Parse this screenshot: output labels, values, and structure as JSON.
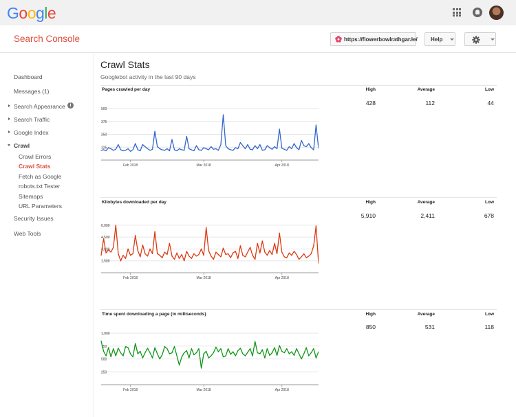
{
  "google_bar": {
    "logo_letters": [
      {
        "ch": "G",
        "color": "#4285f4"
      },
      {
        "ch": "o",
        "color": "#ea4335"
      },
      {
        "ch": "o",
        "color": "#fbbc05"
      },
      {
        "ch": "g",
        "color": "#4285f4"
      },
      {
        "ch": "l",
        "color": "#34a853"
      },
      {
        "ch": "e",
        "color": "#ea4335"
      }
    ],
    "icons": [
      "apps-icon",
      "notifications-icon",
      "account-avatar"
    ]
  },
  "header": {
    "brand": "Search Console",
    "brand_color": "#dd4b39",
    "site_selector": "https://flowerbowlrathgar.ie/",
    "help_label": "Help",
    "settings_icon": "gear-icon"
  },
  "sidebar": {
    "items": [
      {
        "label": "Dashboard",
        "type": "top"
      },
      {
        "label": "Messages (1)",
        "type": "top"
      },
      {
        "label": "Search Appearance",
        "type": "collapsed",
        "info_icon": "i"
      },
      {
        "label": "Search Traffic",
        "type": "collapsed"
      },
      {
        "label": "Google Index",
        "type": "collapsed"
      },
      {
        "label": "Crawl",
        "type": "expanded"
      },
      {
        "label": "Crawl Errors",
        "type": "sub"
      },
      {
        "label": "Crawl Stats",
        "type": "sub-active"
      },
      {
        "label": "Fetch as Google",
        "type": "sub"
      },
      {
        "label": "robots.txt Tester",
        "type": "sub"
      },
      {
        "label": "Sitemaps",
        "type": "sub"
      },
      {
        "label": "URL Parameters",
        "type": "sub"
      },
      {
        "label": "Security Issues",
        "type": "top"
      },
      {
        "label": "Web Tools",
        "type": "top"
      }
    ]
  },
  "main": {
    "title": "Crawl Stats",
    "subtitle": "Googlebot activity in the last 90 days",
    "stat_headers": {
      "high": "High",
      "average": "Average",
      "low": "Low"
    },
    "sections": [
      {
        "title": "Pages crawled per day",
        "high": "428",
        "average": "112",
        "low": "44"
      },
      {
        "title": "Kilobytes downloaded per day",
        "high": "5,910",
        "average": "2,411",
        "low": "678"
      },
      {
        "title": "Time spent downloading a page (in milliseconds)",
        "high": "850",
        "average": "531",
        "low": "118"
      }
    ]
  },
  "chart_data": [
    {
      "type": "line",
      "title": "Pages crawled per day",
      "color": "#3366cc",
      "ylim": [
        0,
        500
      ],
      "yticks": [
        "500",
        "375",
        "250",
        "125"
      ],
      "ytick_values": [
        500,
        375,
        250,
        125
      ],
      "xticks": [
        "Feb 2018",
        "Mar 2018",
        "Apr 2018"
      ],
      "xtick_index": [
        12,
        42,
        74
      ],
      "grid": true,
      "values": [
        95,
        100,
        90,
        120,
        110,
        95,
        105,
        150,
        100,
        90,
        95,
        110,
        85,
        100,
        160,
        100,
        90,
        150,
        130,
        110,
        95,
        105,
        280,
        130,
        110,
        100,
        95,
        110,
        90,
        200,
        100,
        90,
        110,
        100,
        95,
        230,
        110,
        100,
        90,
        140,
        100,
        95,
        120,
        110,
        100,
        130,
        105,
        110,
        95,
        150,
        440,
        140,
        110,
        100,
        95,
        120,
        110,
        170,
        140,
        110,
        150,
        105,
        100,
        140,
        110,
        150,
        95,
        100,
        140,
        120,
        105,
        130,
        110,
        300,
        115,
        105,
        95,
        130,
        110,
        160,
        120,
        100,
        190,
        140,
        130,
        160,
        120,
        100,
        340,
        115
      ]
    },
    {
      "type": "line",
      "title": "Kilobytes downloaded per day",
      "color": "#dc3912",
      "ylim": [
        0,
        6500
      ],
      "yticks": [
        "6,000",
        "4,500",
        "3,000",
        "1,500"
      ],
      "ytick_values": [
        6000,
        4500,
        3000,
        1500
      ],
      "xticks": [
        "Feb 2018",
        "Mar 2018",
        "Apr 2018"
      ],
      "xtick_index": [
        12,
        42,
        74
      ],
      "grid": true,
      "values": [
        2200,
        4300,
        2500,
        2900,
        2600,
        3200,
        6000,
        2400,
        1500,
        2200,
        1800,
        3000,
        2200,
        2400,
        4700,
        2800,
        2000,
        3500,
        2400,
        2100,
        3000,
        2400,
        5200,
        2400,
        2200,
        1900,
        2600,
        2300,
        3700,
        2100,
        1700,
        2500,
        1800,
        2300,
        1500,
        2700,
        2100,
        1800,
        2400,
        2100,
        2300,
        3000,
        2200,
        5700,
        2800,
        2100,
        1700,
        2600,
        2300,
        2000,
        3100,
        2300,
        2400,
        1900,
        2500,
        2700,
        1800,
        3400,
        2200,
        2000,
        2600,
        3200,
        2200,
        1700,
        3700,
        2500,
        4000,
        2600,
        2200,
        2800,
        2300,
        3700,
        2400,
        5000,
        2600,
        2000,
        1900,
        2500,
        2200,
        2700,
        2300,
        1700,
        2000,
        2400,
        1900,
        2100,
        2400,
        3400,
        5900,
        1200
      ]
    },
    {
      "type": "line",
      "title": "Time spent downloading a page (in milliseconds)",
      "color": "#109618",
      "ylim": [
        0,
        1000
      ],
      "yticks": [
        "1,000",
        "750",
        "500",
        "250"
      ],
      "ytick_values": [
        1000,
        750,
        500,
        250
      ],
      "xticks": [
        "Feb 2018",
        "Mar 2018",
        "Apr 2018"
      ],
      "xtick_index": [
        12,
        42,
        74
      ],
      "grid": true,
      "values": [
        850,
        650,
        560,
        720,
        540,
        700,
        560,
        710,
        620,
        560,
        740,
        720,
        600,
        540,
        800,
        600,
        650,
        520,
        620,
        710,
        620,
        520,
        720,
        600,
        500,
        580,
        740,
        700,
        600,
        620,
        740,
        560,
        380,
        540,
        620,
        660,
        520,
        700,
        580,
        620,
        700,
        320,
        600,
        650,
        520,
        560,
        620,
        730,
        640,
        700,
        540,
        560,
        700,
        590,
        640,
        560,
        660,
        710,
        600,
        560,
        630,
        700,
        560,
        840,
        620,
        600,
        680,
        520,
        700,
        570,
        620,
        720,
        570,
        760,
        650,
        620,
        700,
        600,
        640,
        570,
        700,
        600,
        500,
        600,
        720,
        560,
        620,
        700,
        520,
        640
      ]
    }
  ]
}
